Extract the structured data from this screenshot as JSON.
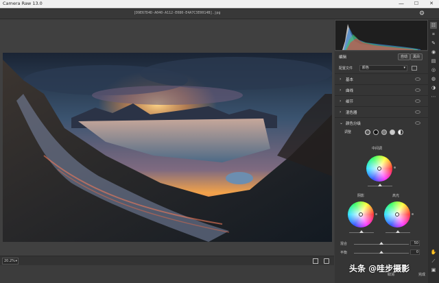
{
  "window": {
    "title": "Camera Raw 13.0",
    "minimize": "—",
    "maximize": "☐",
    "close": "✕"
  },
  "file": {
    "name": "[D9E67D4D-A040-A112-E080-E4A7C3E0014B].jpg"
  },
  "canvas": {
    "zoom": "20.2%"
  },
  "panel": {
    "title": "编辑",
    "auto_label": "自动",
    "bw_label": "黑白",
    "profile_label": "配置文件",
    "profile_value": "颜色",
    "sections": [
      {
        "name": "基本"
      },
      {
        "name": "曲线"
      },
      {
        "name": "细节"
      },
      {
        "name": "混色器"
      },
      {
        "name": "颜色分级"
      }
    ],
    "grading": {
      "adjust_label": "调整",
      "midtones_label": "中间调",
      "shadows_label": "阴影",
      "highlights_label": "高光",
      "blending_label": "混合",
      "blending_value": "50",
      "blending_level": 0.5,
      "balance_label": "平衡",
      "balance_value": "0",
      "balance_level": 0.5
    }
  },
  "toolbar": {
    "icons": [
      "edit-icon",
      "crop-icon",
      "healing-icon",
      "mask-icon",
      "gradient-icon",
      "radial-icon",
      "redeye-icon",
      "presets-icon",
      "more-icon",
      "hand-icon",
      "eyedropper-icon",
      "toggle-icon"
    ]
  },
  "watermark": {
    "text": "头条 @哇步摄影"
  },
  "bottom": {
    "left_label": "取消",
    "right_label": "完成"
  }
}
